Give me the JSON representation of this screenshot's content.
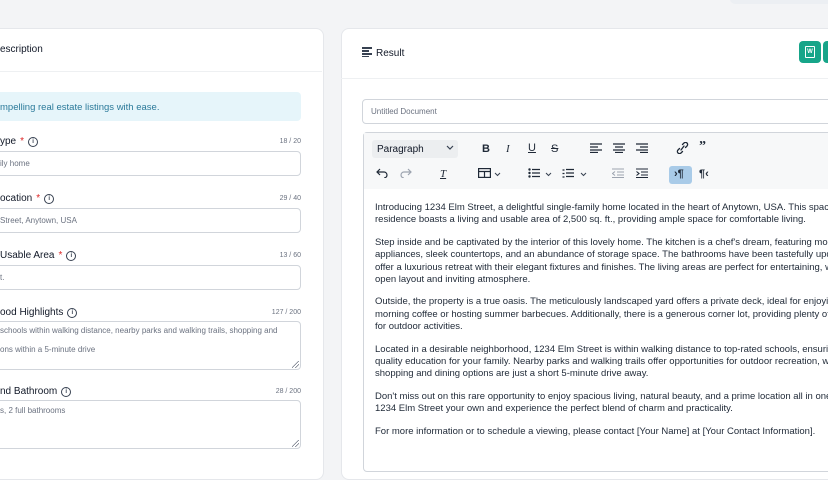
{
  "left_panel": {
    "title": "escription",
    "info": "mpelling real estate listings with ease.",
    "fields": [
      {
        "label": "ype",
        "required": true,
        "count": "18 / 20",
        "value": "ily home"
      },
      {
        "label": "ocation",
        "required": true,
        "count": "29 / 40",
        "value": "Street, Anytown, USA"
      },
      {
        "label": "Usable Area",
        "required": true,
        "count": "13 / 60",
        "value": "t."
      },
      {
        "label": "ood Highlights",
        "required": false,
        "count": "127 / 200",
        "lines": [
          "schools within walking distance, nearby parks and walking trails, shopping and",
          "ons within a 5-minute drive"
        ]
      },
      {
        "label": "nd Bathroom",
        "required": false,
        "count": "28 / 200",
        "lines": [
          "s, 2 full bathrooms"
        ]
      }
    ]
  },
  "result": {
    "title": "Result",
    "doc_title_placeholder": "Untitled Document",
    "toolbar": {
      "paragraph": "Paragraph"
    },
    "paragraphs": [
      [
        "Introducing 1234 Elm Street, a delightful single-family home located in the heart of Anytown, USA. This spacio",
        "residence boasts a living and usable area of 2,500 sq. ft., providing ample space for comfortable living."
      ],
      [
        "Step inside and be captivated by the interior of this lovely home. The kitchen is a chef's dream, featuring mode",
        "appliances, sleek countertops, and an abundance of storage space. The bathrooms have been tastefully update",
        "offer a luxurious retreat with their elegant fixtures and finishes. The living areas are perfect for entertaining, wit",
        "open layout and inviting atmosphere."
      ],
      [
        "Outside, the property is a true oasis. The meticulously landscaped yard offers a private deck, ideal for enjoying",
        "morning coffee or hosting summer barbecues. Additionally, there is a generous corner lot, providing plenty of",
        "for outdoor activities."
      ],
      [
        "Located in a desirable neighborhood, 1234 Elm Street is within walking distance to top-rated schools, ensurin",
        "quality education for your family. Nearby parks and walking trails offer opportunities for outdoor recreation, w",
        "shopping and dining options are just a short 5-minute drive away."
      ],
      [
        "Don't miss out on this rare opportunity to enjoy spacious living, natural beauty, and a prime location all in one",
        "1234 Elm Street your own and experience the perfect blend of charm and practicality."
      ],
      [
        "For more information or to schedule a viewing, please contact [Your Name] at [Your Contact Information]."
      ]
    ]
  },
  "colors": {
    "accent": "#17a589",
    "info_bg": "#e6f5fa",
    "active_tool": "#a9cbe8"
  }
}
